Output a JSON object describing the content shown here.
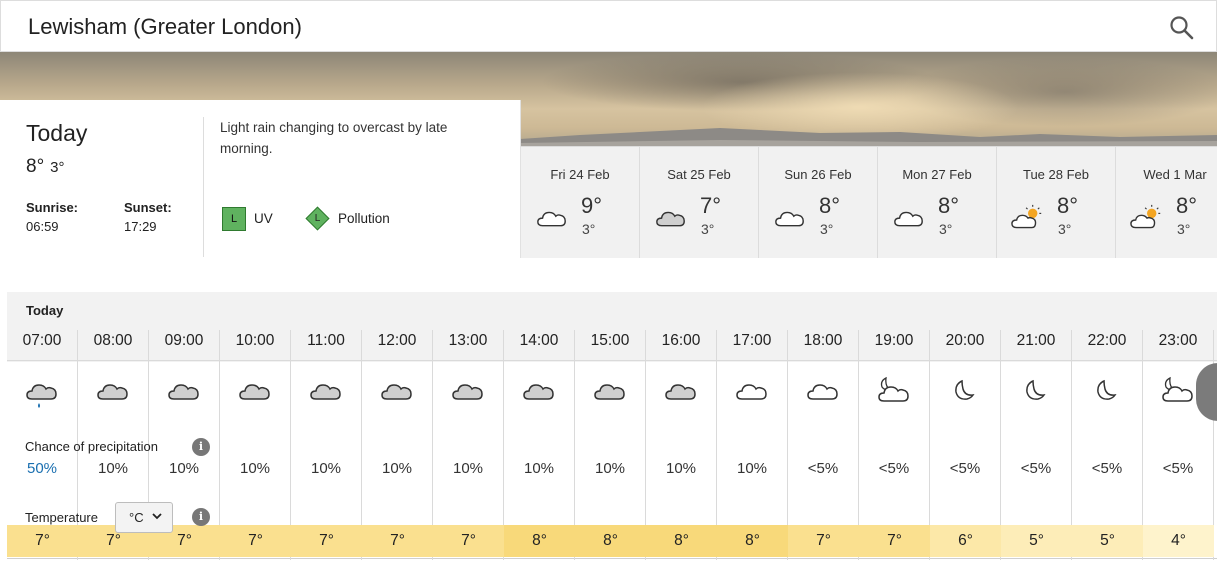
{
  "header": {
    "title": "Lewisham (Greater London)",
    "search_icon": "search-icon"
  },
  "today": {
    "name": "Today",
    "high": "8°",
    "low": "3°",
    "sunrise_label": "Sunrise:",
    "sunrise": "06:59",
    "sunset_label": "Sunset:",
    "sunset": "17:29",
    "summary": "Light rain changing to overcast by late morning.",
    "uv_letter": "L",
    "uv_label": "UV",
    "pollution_letter": "L",
    "pollution_label": "Pollution"
  },
  "days": [
    {
      "label": "Fri 24 Feb",
      "high": "9°",
      "low": "3°",
      "icon": "cloud-icon"
    },
    {
      "label": "Sat 25 Feb",
      "high": "7°",
      "low": "3°",
      "icon": "grey-cloud-icon"
    },
    {
      "label": "Sun 26 Feb",
      "high": "8°",
      "low": "3°",
      "icon": "cloud-icon"
    },
    {
      "label": "Mon 27 Feb",
      "high": "8°",
      "low": "3°",
      "icon": "cloud-icon"
    },
    {
      "label": "Tue 28 Feb",
      "high": "8°",
      "low": "3°",
      "icon": "sun-cloud-icon"
    },
    {
      "label": "Wed 1 Mar",
      "high": "8°",
      "low": "3°",
      "icon": "sun-cloud-icon"
    }
  ],
  "hourly": {
    "title": "Today",
    "precip_title": "Chance of precipitation",
    "temp_title": "Temperature",
    "unit": "°C",
    "hours": [
      {
        "time": "07:00",
        "icon": "light-rain-icon",
        "precip": "50%",
        "temp": "7°"
      },
      {
        "time": "08:00",
        "icon": "grey-cloud-icon",
        "precip": "10%",
        "temp": "7°"
      },
      {
        "time": "09:00",
        "icon": "grey-cloud-icon",
        "precip": "10%",
        "temp": "7°"
      },
      {
        "time": "10:00",
        "icon": "grey-cloud-icon",
        "precip": "10%",
        "temp": "7°"
      },
      {
        "time": "11:00",
        "icon": "grey-cloud-icon",
        "precip": "10%",
        "temp": "7°"
      },
      {
        "time": "12:00",
        "icon": "grey-cloud-icon",
        "precip": "10%",
        "temp": "7°"
      },
      {
        "time": "13:00",
        "icon": "grey-cloud-icon",
        "precip": "10%",
        "temp": "7°"
      },
      {
        "time": "14:00",
        "icon": "grey-cloud-icon",
        "precip": "10%",
        "temp": "8°"
      },
      {
        "time": "15:00",
        "icon": "grey-cloud-icon",
        "precip": "10%",
        "temp": "8°"
      },
      {
        "time": "16:00",
        "icon": "grey-cloud-icon",
        "precip": "10%",
        "temp": "8°"
      },
      {
        "time": "17:00",
        "icon": "cloud-icon",
        "precip": "10%",
        "temp": "8°"
      },
      {
        "time": "18:00",
        "icon": "cloud-icon",
        "precip": "<5%",
        "temp": "7°"
      },
      {
        "time": "19:00",
        "icon": "partly-cloudy-night-icon",
        "precip": "<5%",
        "temp": "7°"
      },
      {
        "time": "20:00",
        "icon": "moon-icon",
        "precip": "<5%",
        "temp": "6°"
      },
      {
        "time": "21:00",
        "icon": "moon-icon",
        "precip": "<5%",
        "temp": "5°"
      },
      {
        "time": "22:00",
        "icon": "moon-icon",
        "precip": "<5%",
        "temp": "5°"
      },
      {
        "time": "23:00",
        "icon": "partly-cloudy-night-icon",
        "precip": "<5%",
        "temp": "4°"
      }
    ]
  },
  "colors": {
    "precip_highlight": "#1a6fb0",
    "temp_8": "#f8d97a",
    "temp_7": "#fae08f",
    "temp_6": "#fce8a8",
    "temp_5": "#fdedb8",
    "temp_4": "#fef3cc",
    "uv_green": "#5fb25f"
  }
}
